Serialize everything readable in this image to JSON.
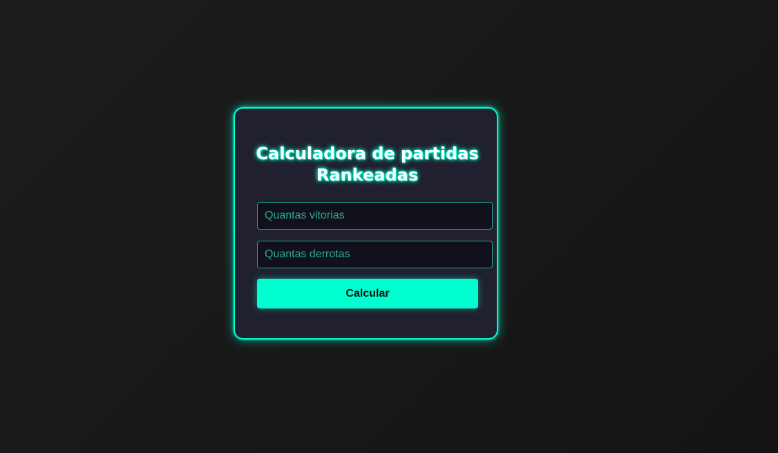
{
  "calculator": {
    "title_line1": "Calculadora de partidas",
    "title_line2": "Rankeadas",
    "wins_placeholder": "Quantas vitorias",
    "losses_placeholder": "Quantas derrotas",
    "submit_label": "Calcular"
  },
  "colors": {
    "accent": "#00ffd0",
    "background": "#181818",
    "card": "#20202f",
    "input_background": "#11111b",
    "button_text": "#0c0c12"
  }
}
